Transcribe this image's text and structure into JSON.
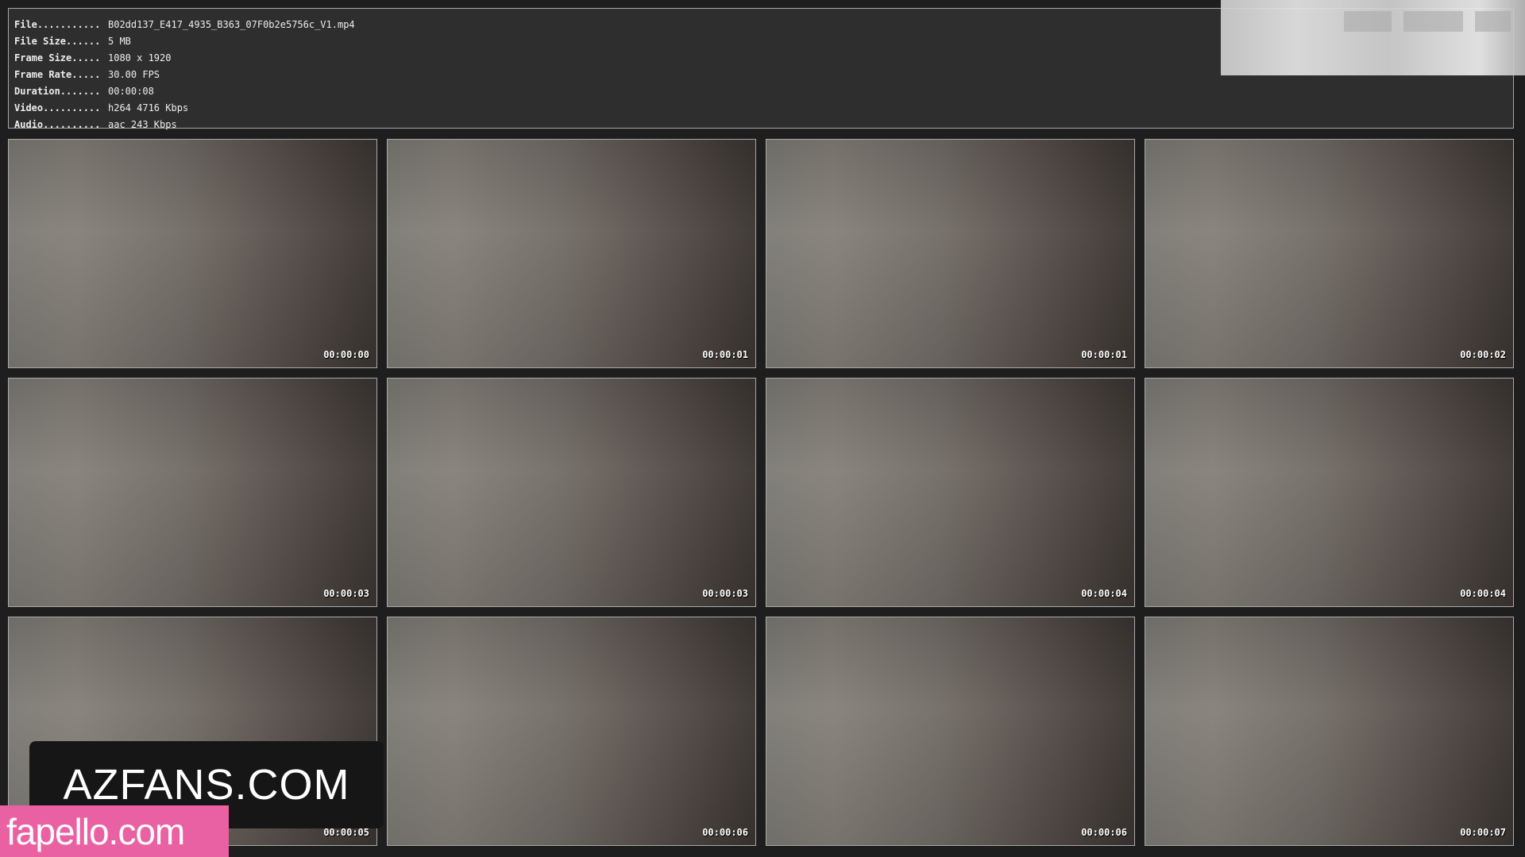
{
  "info": [
    {
      "key": "File...........",
      "value": "B02dd137_E417_4935_B363_07F0b2e5756c_V1.mp4"
    },
    {
      "key": "File Size......",
      "value": "5 MB"
    },
    {
      "key": "Frame Size.....",
      "value": "1080 x 1920"
    },
    {
      "key": "Frame Rate.....",
      "value": "30.00 FPS"
    },
    {
      "key": "Duration.......",
      "value": "00:00:08"
    },
    {
      "key": "Video..........",
      "value": "h264 4716 Kbps"
    },
    {
      "key": "Audio..........",
      "value": "aac 243 Kbps"
    }
  ],
  "thumbnails": [
    {
      "timestamp": "00:00:00"
    },
    {
      "timestamp": "00:00:01"
    },
    {
      "timestamp": "00:00:01"
    },
    {
      "timestamp": "00:00:02"
    },
    {
      "timestamp": "00:00:03"
    },
    {
      "timestamp": "00:00:03"
    },
    {
      "timestamp": "00:00:04"
    },
    {
      "timestamp": "00:00:04"
    },
    {
      "timestamp": "00:00:05"
    },
    {
      "timestamp": "00:00:06"
    },
    {
      "timestamp": "00:00:06"
    },
    {
      "timestamp": "00:00:07"
    }
  ],
  "watermarks": {
    "primary": "AZFANS.COM",
    "secondary": "fapello.com"
  },
  "colors": {
    "background": "#1e1e1e",
    "panel": "#2e2e2e",
    "watermark_pink": "#ea61a3"
  }
}
